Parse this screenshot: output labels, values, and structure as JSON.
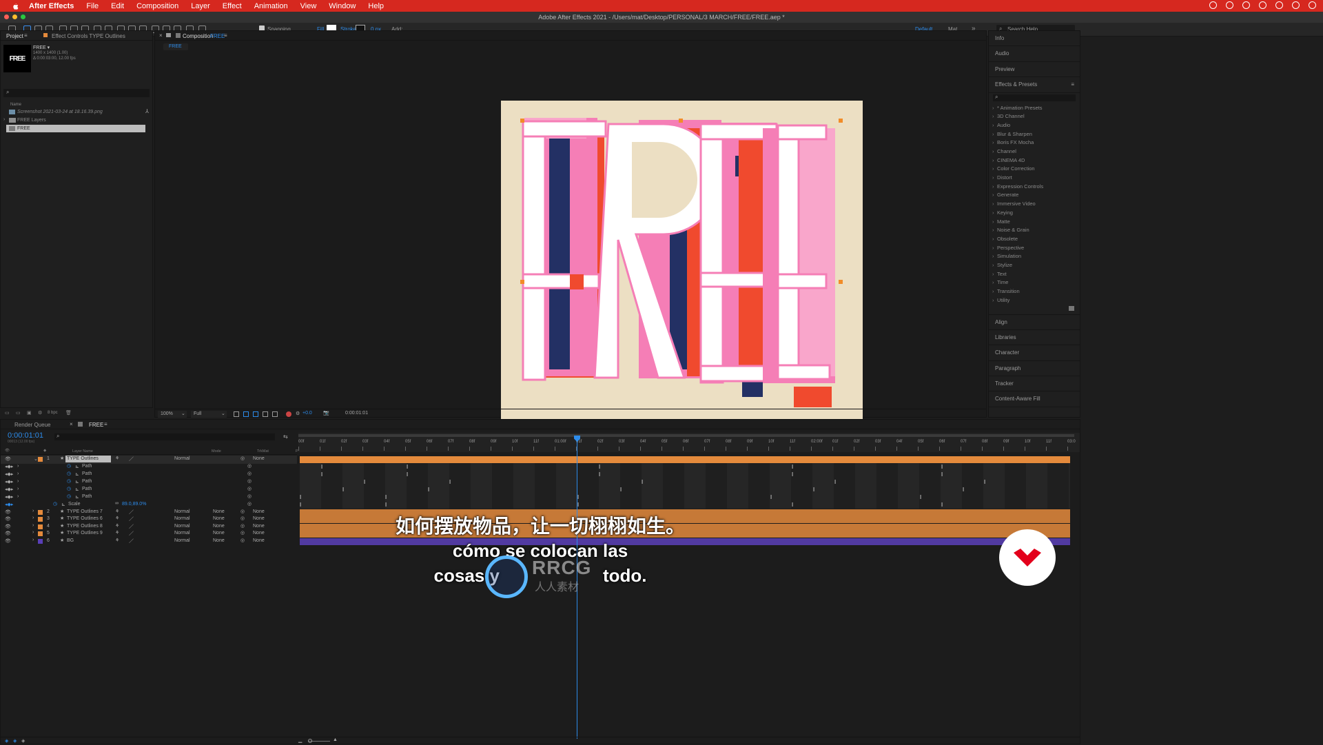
{
  "menubar": {
    "app": "After Effects",
    "items": [
      "File",
      "Edit",
      "Composition",
      "Layer",
      "Effect",
      "Animation",
      "View",
      "Window",
      "Help"
    ]
  },
  "titlebar": {
    "title": "Adobe After Effects 2021 - /Users/mat/Desktop/PERSONAL/3 MARCH/FREE/FREE.aep *"
  },
  "toolbar": {
    "snapping": "Snapping",
    "fill": "Fill",
    "stroke": "Stroke",
    "stroke_px": "0 px",
    "add": "Add:",
    "workspace": "Default",
    "workspace2": "Mat",
    "search_placeholder": "Search Help"
  },
  "project": {
    "tab_project": "Project",
    "tab_effects": "Effect Controls TYPE Outlines",
    "comp_name": "FREE ▾",
    "comp_size": "1400 x 1400 (1.00)",
    "comp_dur": "Δ 0:00:03:00, 12.00 fps",
    "thumb_text": "FREE",
    "col_name": "Name",
    "items": [
      "Screenshot 2021-03-24 at 18.16.39.png",
      "FREE Layers",
      "FREE"
    ],
    "bpc": "8 bpc"
  },
  "comp": {
    "tab": "Composition",
    "tab_name": "FREE",
    "crumb": "FREE",
    "artwork_text": "FREE",
    "zoom": "100%",
    "resolution": "Full",
    "exposure": "+0.0",
    "timecode": "0:00:01:01"
  },
  "right_panel": {
    "top_sections": [
      "Info",
      "Audio",
      "Preview"
    ],
    "effects_title": "Effects & Presets",
    "effects": [
      "* Animation Presets",
      "3D Channel",
      "Audio",
      "Blur & Sharpen",
      "Boris FX Mocha",
      "Channel",
      "CINEMA 4D",
      "Color Correction",
      "Distort",
      "Expression Controls",
      "Generate",
      "Immersive Video",
      "Keying",
      "Matte",
      "Noise & Grain",
      "Obsolete",
      "Perspective",
      "Simulation",
      "Stylize",
      "Text",
      "Time",
      "Transition",
      "Utility"
    ],
    "bottom_sections": [
      "Align",
      "Libraries",
      "Character",
      "Paragraph",
      "Tracker",
      "Content-Aware Fill"
    ]
  },
  "timeline": {
    "tab_render": "Render Queue",
    "tab_comp": "FREE",
    "timecode": "0:00:01:01",
    "fps_label": "00013 (12.00 fps)",
    "col_layer": "Layer Name",
    "col_mode": "Mode",
    "col_trkmat": "TrkMat",
    "col_parent": "Parent & Link",
    "ruler": [
      "00f",
      "01f",
      "02f",
      "03f",
      "04f",
      "05f",
      "06f",
      "07f",
      "08f",
      "09f",
      "10f",
      "11f",
      "01:00f",
      "01f",
      "02f",
      "03f",
      "04f",
      "05f",
      "06f",
      "07f",
      "08f",
      "09f",
      "10f",
      "11f",
      "02:00f",
      "01f",
      "02f",
      "03f",
      "04f",
      "05f",
      "06f",
      "07f",
      "08f",
      "09f",
      "10f",
      "11f",
      "03:0"
    ],
    "layer1": {
      "num": "1",
      "name": "TYPE Outlines",
      "mode": "Normal",
      "parent": "None"
    },
    "paths": [
      "Path",
      "Path",
      "Path",
      "Path",
      "Path"
    ],
    "scale": {
      "label": "Scale",
      "value": "89.0,89.0%"
    },
    "layers": [
      {
        "num": "2",
        "name": "TYPE Outlines 7",
        "mode": "Normal",
        "trkmat": "None",
        "parent": "None",
        "color": "#e48a3c"
      },
      {
        "num": "3",
        "name": "TYPE Outlines 6",
        "mode": "Normal",
        "trkmat": "None",
        "parent": "None",
        "color": "#e48a3c"
      },
      {
        "num": "4",
        "name": "TYPE Outlines 8",
        "mode": "Normal",
        "trkmat": "None",
        "parent": "None",
        "color": "#e48a3c"
      },
      {
        "num": "5",
        "name": "TYPE Outlines 9",
        "mode": "Normal",
        "trkmat": "None",
        "parent": "None",
        "color": "#e48a3c"
      },
      {
        "num": "6",
        "name": "BG",
        "mode": "Normal",
        "trkmat": "None",
        "parent": "None",
        "color": "#5a3fb8"
      }
    ]
  },
  "subtitles": {
    "zh": "如何摆放物品，让一切栩栩如生。",
    "es1": "cómo se colocan las",
    "es2a": "cosas y",
    "es2b": "todo."
  },
  "watermark": {
    "text": "RRCG",
    "sub": "人人素材"
  },
  "colors": {
    "menubar": "#d6281f",
    "accent": "#2d8ceb",
    "layer_orange": "#e48a3c",
    "layer_purple": "#5a3fb8",
    "art_bg": "#ecdfc3",
    "art_pink": "#f57eb6",
    "art_red": "#f04a2e",
    "art_navy": "#233064"
  }
}
